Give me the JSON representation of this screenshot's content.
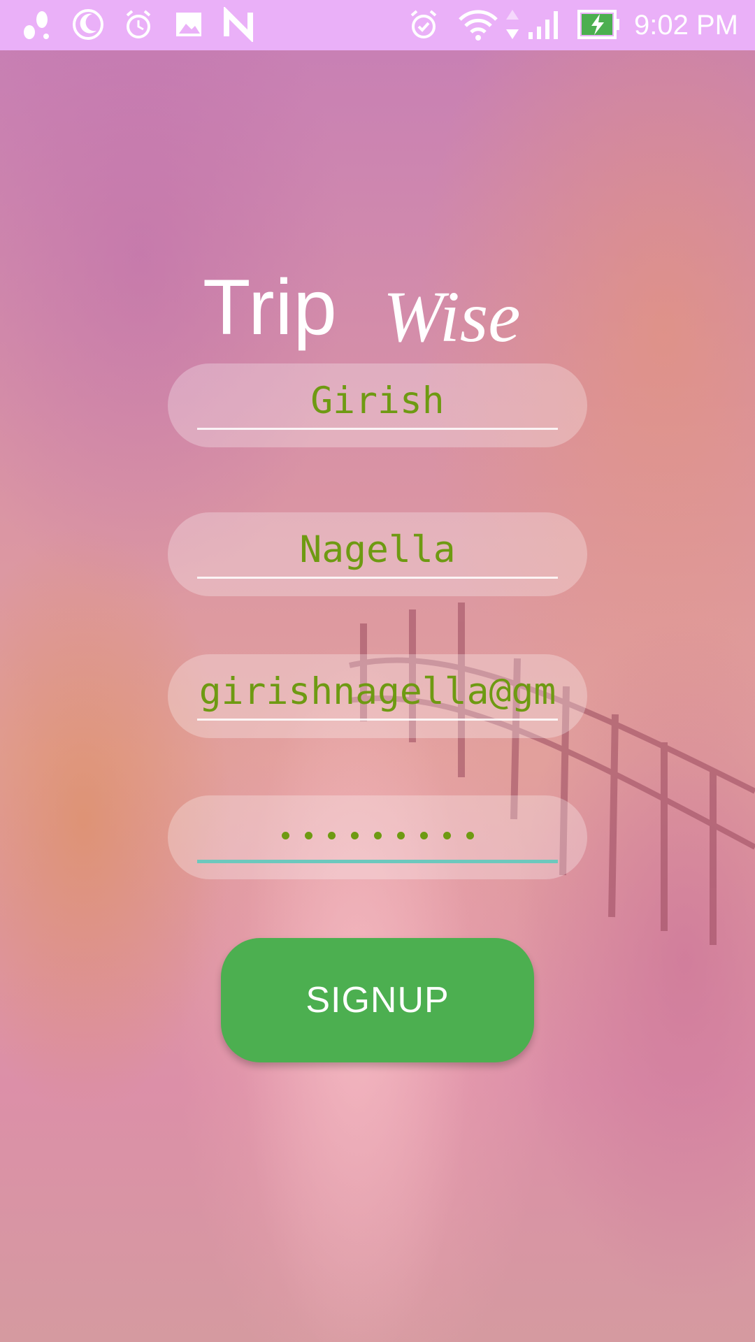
{
  "status_bar": {
    "time": "9:02 PM",
    "left_icons": [
      "notification-icon",
      "moon-icon",
      "alarm-clock-icon",
      "image-icon",
      "n-app-icon"
    ],
    "right_icons": [
      "alarm-icon",
      "wifi-icon",
      "data-arrows-icon",
      "cell-signal-icon",
      "battery-charging-icon"
    ],
    "background_color": "#eab0f8"
  },
  "logo": {
    "word1": "Trip",
    "word2": "Wise"
  },
  "form": {
    "first_name": "Girish",
    "last_name": "Nagella",
    "email": "girishnagella@gm",
    "password_dots": 9,
    "signup_label": "SIGNUP",
    "text_color": "#6e9a12",
    "button_color": "#4caf50",
    "focus_color": "#6cc8bd"
  }
}
